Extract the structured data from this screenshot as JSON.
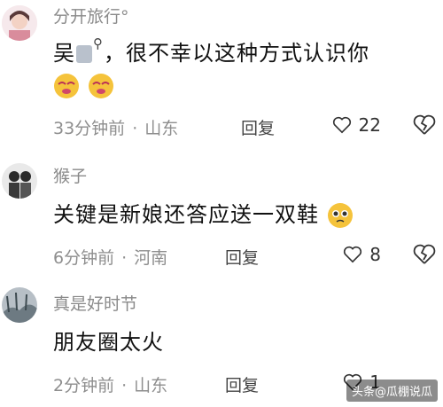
{
  "comments": [
    {
      "username": "分开旅行°",
      "body_prefix": "吴",
      "body_text": "，很不幸以这种方式认识你",
      "time": "33分钟前",
      "location": "山东",
      "reply_label": "回复",
      "likes": "22",
      "emojis": [
        "shy-face-emoji",
        "shy-face-emoji"
      ]
    },
    {
      "username": "猴子",
      "body_text": "关键是新娘还答应送一双鞋",
      "time": "6分钟前",
      "location": "河南",
      "reply_label": "回复",
      "likes": "8",
      "emojis": [
        "pleading-face-emoji"
      ]
    },
    {
      "username": "真是好时节",
      "body_text": "朋友圈太火",
      "time": "2分钟前",
      "location": "山东",
      "reply_label": "回复",
      "likes": "1"
    }
  ],
  "watermark": "头条@瓜棚说瓜",
  "colors": {
    "username": "#8a8a8a",
    "body": "#111111",
    "meta": "#8e8e8e",
    "emoji": "#f5c33b"
  }
}
